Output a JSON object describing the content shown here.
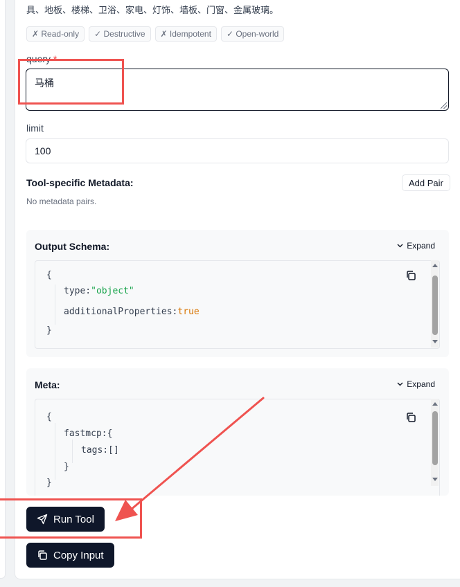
{
  "tool": {
    "description": "具、地板、楼梯、卫浴、家电、灯饰、墙板、门窗、金属玻璃。",
    "badges": [
      "✗ Read-only",
      "✓ Destructive",
      "✗ Idempotent",
      "✓ Open-world"
    ]
  },
  "form": {
    "query_label": "query",
    "query_required": "*",
    "query_value": "马桶",
    "limit_label": "limit",
    "limit_value": "100"
  },
  "metadata": {
    "title": "Tool-specific Metadata:",
    "add_pair_label": "Add Pair",
    "empty_text": "No metadata pairs."
  },
  "output_schema": {
    "title": "Output Schema:",
    "expand_label": "Expand",
    "lines": {
      "open": "{",
      "type_key": "type:",
      "type_value": "\"object\"",
      "addl_key": "additionalProperties:",
      "addl_value": "true",
      "close": "}"
    }
  },
  "meta": {
    "title": "Meta:",
    "expand_label": "Expand",
    "lines": {
      "open": "{",
      "fastmcp_key": "fastmcp:",
      "fastmcp_open": "{",
      "tags_key": "tags:",
      "tags_value": "[]",
      "inner_close": "}",
      "close": "}"
    }
  },
  "actions": {
    "run_tool_label": "Run Tool",
    "copy_input_label": "Copy Input"
  },
  "colors": {
    "annotation_red": "#ef5350",
    "button_dark": "#0f172a",
    "string_green": "#16a34a",
    "boolean_orange": "#d97706"
  }
}
